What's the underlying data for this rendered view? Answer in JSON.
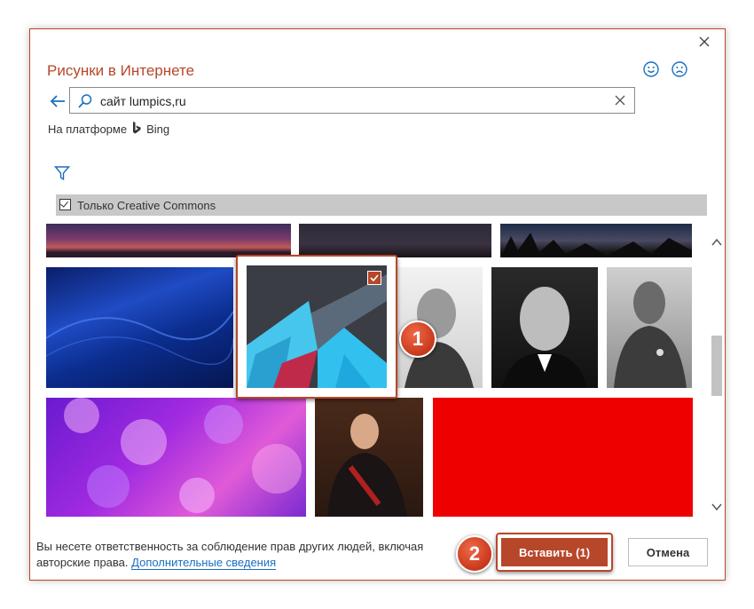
{
  "dialog": {
    "title": "Рисунки в Интернете",
    "close_icon": "close-icon",
    "feedback": [
      "smile-icon",
      "frown-icon"
    ]
  },
  "search": {
    "value": "сайт lumpics,ru",
    "icon": "search-icon",
    "clear_icon": "clear-icon"
  },
  "platform": {
    "label": "На платформе",
    "brand": "Bing"
  },
  "filter": {
    "icon": "filter-icon",
    "creative_commons_label": "Только Creative Commons",
    "creative_commons_checked": true
  },
  "gallery": {
    "selected_count": 1,
    "items": [
      {
        "name": "mountain-sunset-panorama",
        "selected": false
      },
      {
        "name": "night-mountain-panorama",
        "selected": false
      },
      {
        "name": "forest-night-sky",
        "selected": false
      },
      {
        "name": "blue-abstract-waves",
        "selected": false
      },
      {
        "name": "abstract-arrow-graphic",
        "selected": true
      },
      {
        "name": "old-man-portrait",
        "selected": false
      },
      {
        "name": "man-in-suit-portrait",
        "selected": false
      },
      {
        "name": "military-officer-portrait",
        "selected": false
      },
      {
        "name": "purple-bokeh",
        "selected": false
      },
      {
        "name": "nobleman-painting",
        "selected": false
      },
      {
        "name": "red-square",
        "selected": false
      }
    ]
  },
  "annotations": {
    "step1": "1",
    "step2": "2"
  },
  "footer": {
    "notice": "Вы несете ответственность за соблюдение прав других людей, включая авторские права.",
    "link": "Дополнительные сведения",
    "insert_label": "Вставить (1)",
    "cancel_label": "Отмена"
  },
  "colors": {
    "accent": "#b7472a",
    "link": "#1a6fbf",
    "filter_bar": "#c8c8c8"
  }
}
